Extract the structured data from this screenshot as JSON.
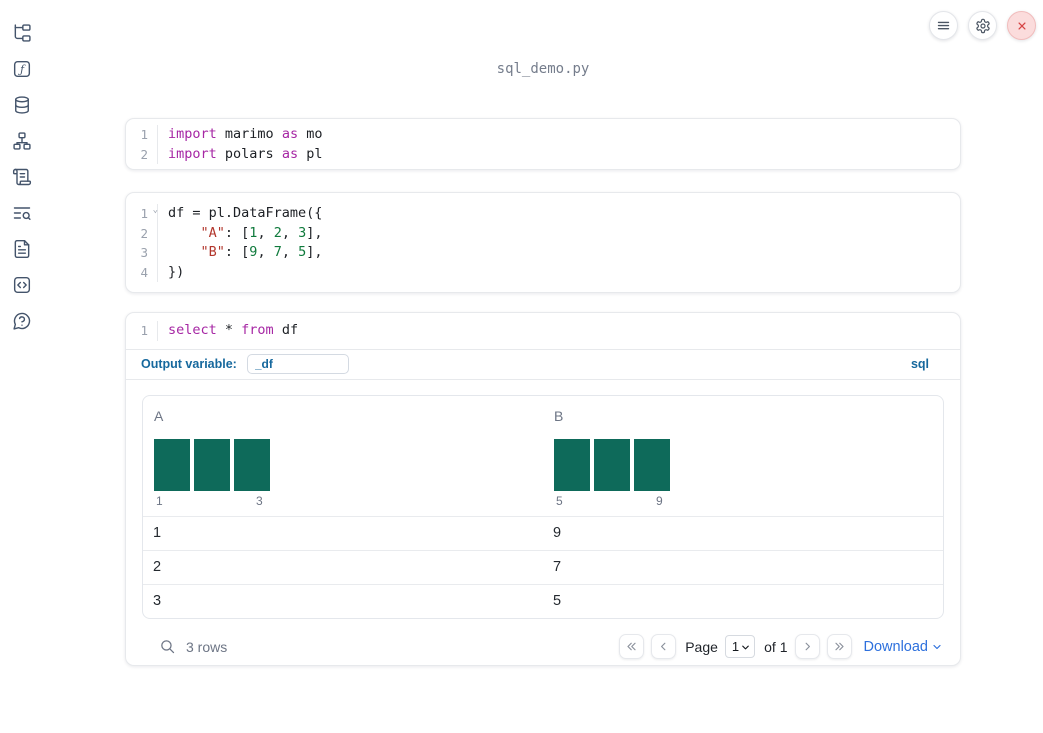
{
  "app": {
    "title": "sql_demo.py"
  },
  "sidebar": {
    "items": [
      {
        "name": "file-explorer",
        "icon": "file-tree-icon"
      },
      {
        "name": "variables",
        "icon": "function-square-icon"
      },
      {
        "name": "datasources",
        "icon": "database-icon"
      },
      {
        "name": "dependency-graph",
        "icon": "network-icon"
      },
      {
        "name": "scratchpad",
        "icon": "scroll-text-icon"
      },
      {
        "name": "logs",
        "icon": "text-search-icon"
      },
      {
        "name": "documentation",
        "icon": "file-text-icon"
      },
      {
        "name": "snippets",
        "icon": "code-square-icon"
      },
      {
        "name": "help",
        "icon": "help-circle-icon"
      }
    ]
  },
  "toolbar": {
    "menu_icon": "hamburger-menu-icon",
    "settings_icon": "gear-icon",
    "close_icon": "close-icon"
  },
  "cells": [
    {
      "lines": [
        {
          "num": "1",
          "tokens": [
            {
              "t": "import",
              "c": "kw"
            },
            {
              "t": " marimo ",
              "c": "d"
            },
            {
              "t": "as",
              "c": "kw"
            },
            {
              "t": " mo",
              "c": "d"
            }
          ]
        },
        {
          "num": "2",
          "tokens": [
            {
              "t": "import",
              "c": "kw"
            },
            {
              "t": " polars ",
              "c": "d"
            },
            {
              "t": "as",
              "c": "kw"
            },
            {
              "t": " pl",
              "c": "d"
            }
          ]
        }
      ]
    },
    {
      "lines": [
        {
          "num": "1",
          "fold": true,
          "tokens": [
            {
              "t": "df = pl.DataFrame({",
              "c": "d"
            }
          ]
        },
        {
          "num": "2",
          "tokens": [
            {
              "t": "    ",
              "c": "d"
            },
            {
              "t": "\"A\"",
              "c": "str"
            },
            {
              "t": ": [",
              "c": "d"
            },
            {
              "t": "1",
              "c": "num"
            },
            {
              "t": ", ",
              "c": "d"
            },
            {
              "t": "2",
              "c": "num"
            },
            {
              "t": ", ",
              "c": "d"
            },
            {
              "t": "3",
              "c": "num"
            },
            {
              "t": "],",
              "c": "d"
            }
          ]
        },
        {
          "num": "3",
          "tokens": [
            {
              "t": "    ",
              "c": "d"
            },
            {
              "t": "\"B\"",
              "c": "str"
            },
            {
              "t": ": [",
              "c": "d"
            },
            {
              "t": "9",
              "c": "num"
            },
            {
              "t": ", ",
              "c": "d"
            },
            {
              "t": "7",
              "c": "num"
            },
            {
              "t": ", ",
              "c": "d"
            },
            {
              "t": "5",
              "c": "num"
            },
            {
              "t": "],",
              "c": "d"
            }
          ]
        },
        {
          "num": "4",
          "tokens": [
            {
              "t": "})",
              "c": "d"
            }
          ]
        }
      ]
    },
    {
      "lines": [
        {
          "num": "1",
          "tokens": [
            {
              "t": "select",
              "c": "kw"
            },
            {
              "t": " * ",
              "c": "d"
            },
            {
              "t": "from",
              "c": "kw"
            },
            {
              "t": " df",
              "c": "d"
            }
          ]
        }
      ]
    }
  ],
  "sql_cell": {
    "output_variable_label": "Output variable:",
    "output_variable_value": "_df",
    "language_badge": "sql"
  },
  "table": {
    "columns": [
      {
        "label": "A",
        "axis_min": "1",
        "axis_max": "3"
      },
      {
        "label": "B",
        "axis_min": "5",
        "axis_max": "9"
      }
    ],
    "rows": [
      [
        "1",
        "9"
      ],
      [
        "2",
        "7"
      ],
      [
        "3",
        "5"
      ]
    ]
  },
  "table_footer": {
    "row_count": "3 rows",
    "page_label": "Page",
    "page_value": "1",
    "of_label": "of 1",
    "download_label": "Download"
  },
  "colors": {
    "keyword_purple": "#a626a4",
    "string_red": "#b2362c",
    "number_green": "#0f7a3c",
    "accent_blue": "#16689d",
    "link_blue": "#2d70dd",
    "histogram_teal": "#0e6a5a",
    "sidebar_icon": "#44546b",
    "close_red": "#d64444"
  },
  "chart_data": [
    {
      "type": "bar",
      "title": "Column A histogram",
      "categories": [
        1,
        2,
        3
      ],
      "values": [
        1,
        1,
        1
      ],
      "xlabel": "",
      "ylabel": "",
      "x_axis_labels": [
        "1",
        "3"
      ],
      "grid": false,
      "legend": "none"
    },
    {
      "type": "bar",
      "title": "Column B histogram",
      "categories": [
        5,
        7,
        9
      ],
      "values": [
        1,
        1,
        1
      ],
      "xlabel": "",
      "ylabel": "",
      "x_axis_labels": [
        "5",
        "9"
      ],
      "grid": false,
      "legend": "none"
    }
  ]
}
